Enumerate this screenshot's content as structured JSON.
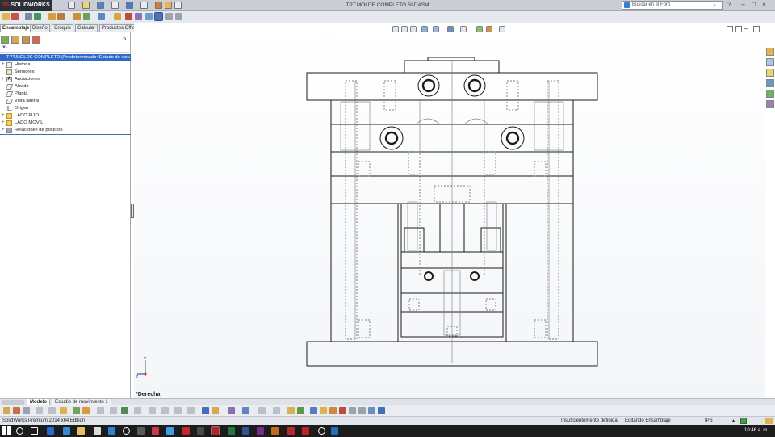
{
  "app": {
    "logo_brand": "3S",
    "logo_name": "SOLIDWORKS",
    "document_title": "TPT.MOLDE COMPLETO.SLDASM",
    "search_placeholder": "Buscar en el Foro"
  },
  "command_tabs": [
    "Ensamblaje",
    "Diseño",
    "Croquis",
    "Calcular",
    "Productos Office"
  ],
  "tree": {
    "filter_icon": "filter-icon",
    "root_label": "TPT.MOLDE COMPLETO  (Predeterminado<Estado de visu",
    "items": [
      {
        "label": "Historial",
        "icon": "history-icon"
      },
      {
        "label": "Sensores",
        "icon": "sensor-icon"
      },
      {
        "label": "Anotaciones",
        "icon": "annotation-icon"
      },
      {
        "label": "Alzado",
        "icon": "plane-icon"
      },
      {
        "label": "Planta",
        "icon": "plane-icon"
      },
      {
        "label": "Vista lateral",
        "icon": "plane-icon"
      },
      {
        "label": "Origen",
        "icon": "origin-icon"
      },
      {
        "label": "LADO FIJO",
        "icon": "folder-icon"
      },
      {
        "label": "LADO MOVIL",
        "icon": "folder-icon"
      },
      {
        "label": "Relaciones de posición",
        "icon": "mates-icon"
      }
    ]
  },
  "viewport": {
    "view_name": "*Derecha",
    "triad_y": "Y",
    "triad_z": "Z"
  },
  "bottom_tabs": {
    "model_tab": "Modelo",
    "motion_tab": "Estudio de movimiento 1"
  },
  "status": {
    "edition": "SolidWorks Premium 2014 x64 Edition",
    "definition": "Insuficientemente definida",
    "mode": "Editando Ensamblaje",
    "units": "IPS",
    "units_arrow": "▲"
  },
  "taskbar": {
    "clock": "10:46 a. m."
  },
  "colors": {
    "selection_blue": "#3169c6",
    "title_bar": "#c9ced6",
    "taskbar": "#1c1c1c",
    "drawing_line": "#1a1a1a"
  }
}
